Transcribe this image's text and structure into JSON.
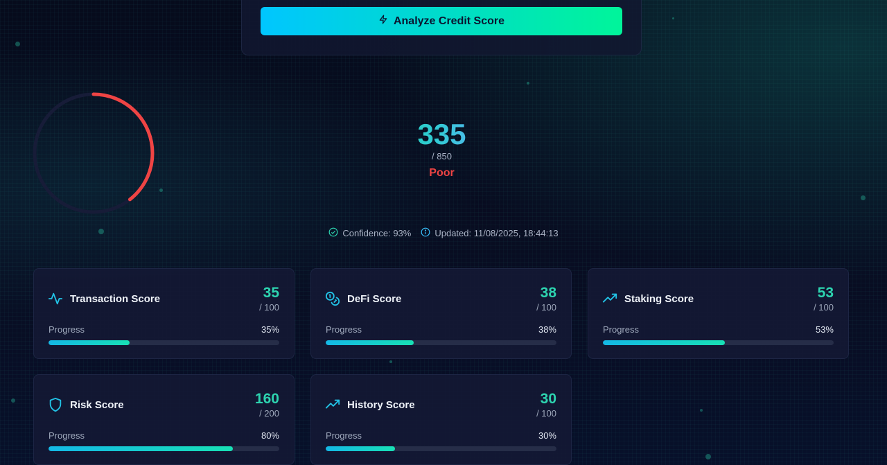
{
  "analyze_button": {
    "label": "Analyze Credit Score",
    "icon": "lightning-icon"
  },
  "score": {
    "value": "335",
    "max": "/ 850",
    "rating": "Poor",
    "rating_color": "#ef4444",
    "gauge_fraction": 0.394
  },
  "meta": {
    "confidence": "Confidence: 93%",
    "updated": "Updated: 11/08/2025, 18:44:13"
  },
  "progress_label": "Progress",
  "cards": [
    {
      "id": "transaction",
      "title": "Transaction Score",
      "value": "35",
      "max": "/ 100",
      "percent_label": "35%",
      "progress": 0.35,
      "icon": "activity-icon"
    },
    {
      "id": "defi",
      "title": "DeFi Score",
      "value": "38",
      "max": "/ 100",
      "percent_label": "38%",
      "progress": 0.38,
      "icon": "coins-icon"
    },
    {
      "id": "staking",
      "title": "Staking Score",
      "value": "53",
      "max": "/ 100",
      "percent_label": "53%",
      "progress": 0.53,
      "icon": "trending-up-icon"
    },
    {
      "id": "risk",
      "title": "Risk Score",
      "value": "160",
      "max": "/ 200",
      "percent_label": "80%",
      "progress": 0.8,
      "icon": "shield-icon"
    },
    {
      "id": "history",
      "title": "History Score",
      "value": "30",
      "max": "/ 100",
      "percent_label": "30%",
      "progress": 0.3,
      "icon": "trending-up-icon"
    }
  ],
  "colors": {
    "accent_teal": "#2dd4b0",
    "accent_cyan": "#00c6ff",
    "card_bg": "#14183a",
    "danger": "#ef4444"
  }
}
